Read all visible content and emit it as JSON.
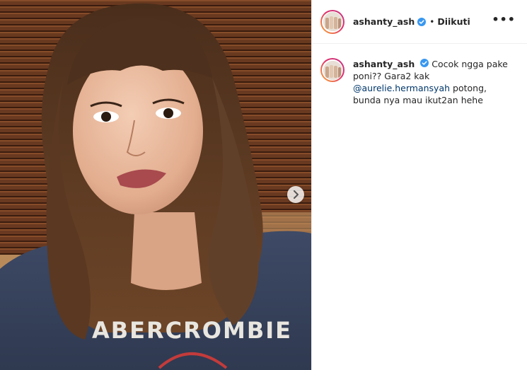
{
  "post": {
    "username": "ashanty_ash",
    "follow_status": "Diikuti",
    "separator": "•",
    "more_label": "•••",
    "caption": {
      "username": "ashanty_ash",
      "text_part1": "Cocok ngga pake poni?? Gara2 kak",
      "mention": "@aurelie.hermansyah",
      "text_part2": "potong, bunda nya mau ikut2an hehe"
    },
    "shirt_text": "ABERCROMBIE",
    "icons": {
      "verified": "verified-badge-icon",
      "next": "chevron-right-icon",
      "more": "more-options-icon"
    },
    "colors": {
      "verified_blue": "#3897f0",
      "mention": "#00376b",
      "story_ring_start": "#f9b233",
      "story_ring_end": "#c13584"
    }
  }
}
